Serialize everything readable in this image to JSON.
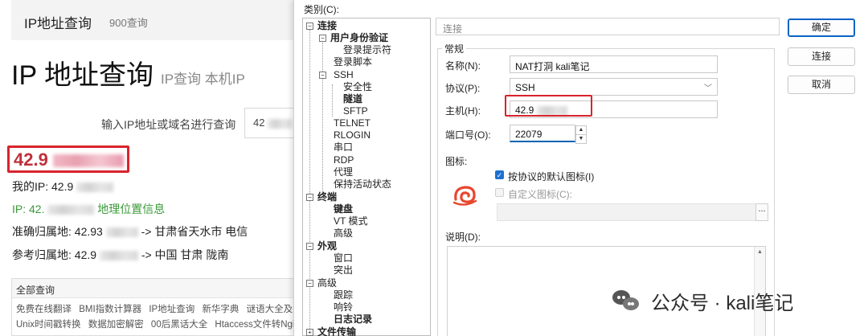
{
  "web": {
    "brand": "IP地址查询",
    "visit_count": "900查询",
    "big_title": "IP 地址查询",
    "big_subtitle": "IP查询 本机IP",
    "query_label": "输入IP地址或域名进行查询",
    "query_value_prefix": "42",
    "result_ip_prefix": "42.9",
    "my_ip_label": "我的IP: 42.9",
    "ip_geo_prefix": "IP: 42.",
    "ip_geo_suffix": "地理位置信息",
    "exact_label": "准确归属地: 42.93",
    "exact_value": "-> 甘肃省天水市 电信",
    "ref_label": "参考归属地: 42.9",
    "ref_value": "-> 中国 甘肃 陇南",
    "links_header": "全部查询",
    "links_row1": [
      "免费在线翻译",
      "BMI指数计算器",
      "IP地址查询",
      "新华字典",
      "谜语大全及答"
    ],
    "links_row2": [
      "Unix时间戳转换",
      "数据加密解密",
      "00后黑话大全",
      "Htaccess文件转Ngin"
    ]
  },
  "dialog": {
    "category_label": "类别(C):",
    "tree": {
      "connection": "连接",
      "user_auth": "用户身份验证",
      "login_prompt": "登录提示符",
      "login_script": "登录脚本",
      "ssh": "SSH",
      "security": "安全性",
      "tunnel": "隧道",
      "sftp": "SFTP",
      "telnet": "TELNET",
      "rlogin": "RLOGIN",
      "serial": "串口",
      "rdp": "RDP",
      "proxy": "代理",
      "keepalive": "保持活动状态",
      "terminal": "终端",
      "keyboard": "键盘",
      "vt_mode": "VT 模式",
      "advanced_term": "高级",
      "appearance": "外观",
      "window": "窗口",
      "highlight": "突出",
      "advanced": "高级",
      "trace": "跟踪",
      "bell": "响铃",
      "logging": "日志记录",
      "file_transfer": "文件传输"
    },
    "section_name": "连接",
    "group_title": "常规",
    "fields": {
      "name_label": "名称(N):",
      "name_value": "NAT打洞 kali笔记",
      "protocol_label": "协议(P):",
      "protocol_value": "SSH",
      "host_label": "主机(H):",
      "host_value_prefix": "42.9",
      "port_label": "端口号(O):",
      "port_value": "22079"
    },
    "icon_section": {
      "label": "图标:",
      "default_icon_label": "按协议的默认图标(I)",
      "default_icon_checked": true,
      "custom_icon_label": "自定义图标(C):",
      "custom_icon_checked": false,
      "browse_label": "..."
    },
    "description_label": "说明(D):",
    "buttons": {
      "ok": "确定",
      "connect": "连接",
      "cancel": "取消"
    }
  },
  "watermark": {
    "text": "公众号 · kali笔记"
  },
  "colors": {
    "highlight_red": "#d9232d",
    "accent_blue": "#1e6fd1",
    "geo_green": "#3a9a3a"
  }
}
